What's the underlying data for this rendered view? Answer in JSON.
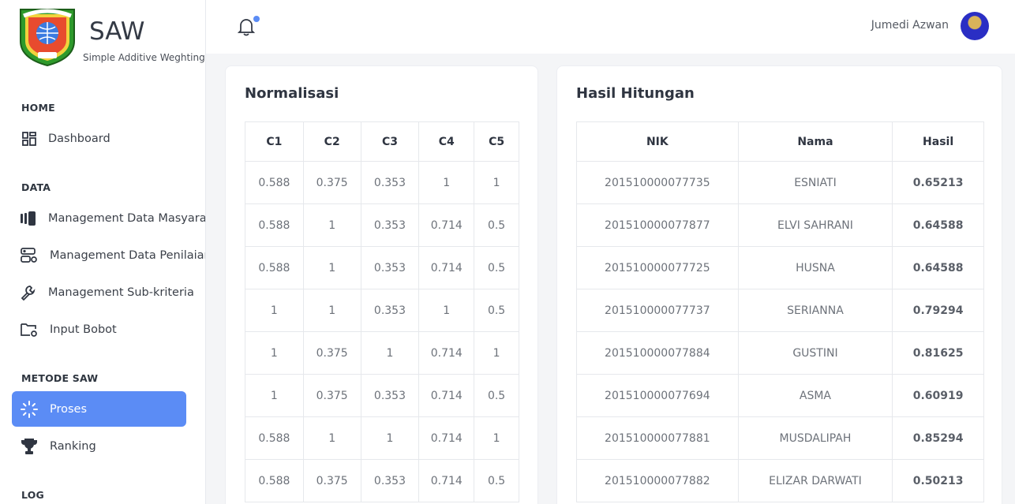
{
  "brand": {
    "title": "SAW",
    "subtitle": "Simple Additive Weghting"
  },
  "sidebar": {
    "sections": [
      {
        "label": "HOME"
      },
      {
        "label": "DATA"
      },
      {
        "label": "METODE SAW"
      },
      {
        "label": "LOG"
      }
    ],
    "items": [
      {
        "label": "Dashboard",
        "icon": "dashboard-grid-icon"
      },
      {
        "label": "Management Data Masyarakat",
        "icon": "cards-stack-icon"
      },
      {
        "label": "Management Data Penilaian",
        "icon": "server-gear-icon"
      },
      {
        "label": "Management Sub-kriteria",
        "icon": "wrench-icon"
      },
      {
        "label": "Input Bobot",
        "icon": "folder-gear-icon"
      },
      {
        "label": "Proses",
        "icon": "loader-icon",
        "active": true
      },
      {
        "label": "Ranking",
        "icon": "trophy-icon"
      }
    ]
  },
  "topbar": {
    "user_name": "Jumedi Azwan",
    "notification": true
  },
  "normalisasi": {
    "title": "Normalisasi",
    "columns": [
      "C1",
      "C2",
      "C3",
      "C4",
      "C5"
    ],
    "rows": [
      [
        "0.588",
        "0.375",
        "0.353",
        "1",
        "1"
      ],
      [
        "0.588",
        "1",
        "0.353",
        "0.714",
        "0.5"
      ],
      [
        "0.588",
        "1",
        "0.353",
        "0.714",
        "0.5"
      ],
      [
        "1",
        "1",
        "0.353",
        "1",
        "0.5"
      ],
      [
        "1",
        "0.375",
        "1",
        "0.714",
        "1"
      ],
      [
        "1",
        "0.375",
        "0.353",
        "0.714",
        "0.5"
      ],
      [
        "0.588",
        "1",
        "1",
        "0.714",
        "1"
      ],
      [
        "0.588",
        "0.375",
        "0.353",
        "0.714",
        "0.5"
      ]
    ]
  },
  "hasil": {
    "title": "Hasil Hitungan",
    "columns": [
      "NIK",
      "Nama",
      "Hasil"
    ],
    "rows": [
      [
        "201510000077735",
        "ESNIATI",
        "0.65213"
      ],
      [
        "201510000077877",
        "ELVI SAHRANI",
        "0.64588"
      ],
      [
        "201510000077725",
        "HUSNA",
        "0.64588"
      ],
      [
        "201510000077737",
        "SERIANNA",
        "0.79294"
      ],
      [
        "201510000077884",
        "GUSTINI",
        "0.81625"
      ],
      [
        "201510000077694",
        "ASMA",
        "0.60919"
      ],
      [
        "201510000077881",
        "MUSDALIPAH",
        "0.85294"
      ],
      [
        "201510000077882",
        "ELIZAR DARWATI",
        "0.50213"
      ]
    ]
  },
  "colors": {
    "accent": "#5b8cf5",
    "sidebar_bg": "#ffffff",
    "page_bg": "#f4f5f7"
  }
}
